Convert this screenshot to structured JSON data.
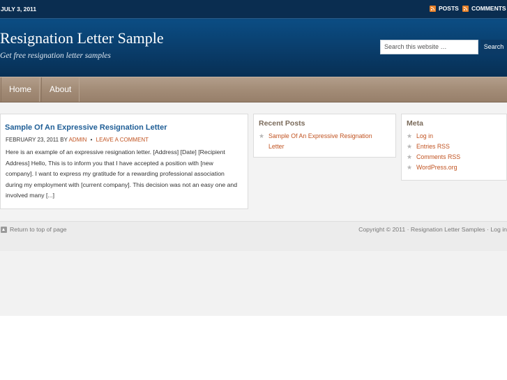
{
  "topbar": {
    "date": "JULY 3, 2011",
    "posts_label": "POSTS",
    "comments_label": "COMMENTS"
  },
  "header": {
    "title": "Resignation Letter Sample",
    "description": "Get free resignation letter samples"
  },
  "search": {
    "placeholder": "Search this website …",
    "button_label": "Search"
  },
  "nav": {
    "items": [
      {
        "label": "Home"
      },
      {
        "label": "About"
      }
    ]
  },
  "post": {
    "title": "Sample Of An Expressive Resignation Letter",
    "date_by": "FEBRUARY 23, 2011 BY",
    "author": "ADMIN",
    "separator": "•",
    "comment_link": "LEAVE A COMMENT",
    "excerpt": "Here is an example of an expressive resignation letter. [Address] [Date] [Recipient Address] Hello, This is to inform you that I have accepted a position with [new company]. I want to express my gratitude for a rewarding professional association during my employment with [current company]. This decision was not an easy one and involved many [...]"
  },
  "recent_posts": {
    "title": "Recent Posts",
    "items": [
      "Sample Of An Expressive Resignation Letter"
    ]
  },
  "meta": {
    "title": "Meta",
    "items": [
      "Log in",
      "Entries RSS",
      "Comments RSS",
      "WordPress.org"
    ]
  },
  "footer": {
    "back_to_top": "Return to top of page",
    "copyright": "Copyright © 2011 · Resignation Letter Samples · Log in"
  },
  "icons": {
    "feed": "rss-icon",
    "bullet": "star-bullet-icon",
    "top": "back-to-top-icon"
  },
  "colors": {
    "header_blue": "#0b4c82",
    "nav_brown": "#a38c77",
    "link_orange": "#c15321",
    "title_blue": "#1f5e96"
  }
}
